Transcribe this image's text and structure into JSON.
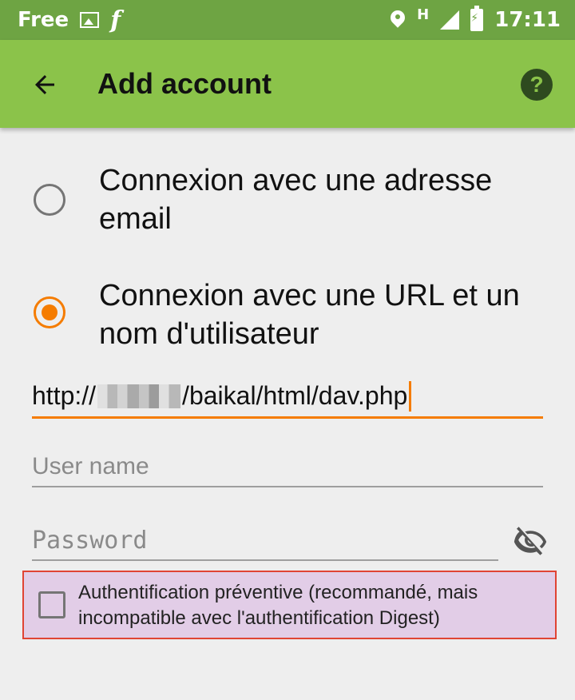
{
  "status_bar": {
    "carrier": "Free",
    "network_type": "H",
    "time": "17:11"
  },
  "toolbar": {
    "title": "Add account",
    "back_icon": "arrow-left-icon",
    "help_icon": "help-circle-icon",
    "help_glyph": "?"
  },
  "login_options": [
    {
      "label": "Connexion avec une adresse email",
      "selected": false
    },
    {
      "label": "Connexion avec une URL et un nom d'utilisateur",
      "selected": true
    }
  ],
  "url_field": {
    "prefix": "http://",
    "suffix": "/baikal/html/dav.php"
  },
  "username_field": {
    "placeholder": "User name",
    "value": ""
  },
  "password_field": {
    "placeholder": "Password",
    "value": ""
  },
  "preemptive_auth": {
    "label": "Authentification préventive (recommandé, mais incompatible avec l'authentification Digest)",
    "checked": false
  },
  "colors": {
    "status_bar": "#6ea443",
    "toolbar": "#8bc34a",
    "accent": "#f57c00",
    "highlight_bg": "#e2cde7",
    "highlight_border": "#e04434"
  }
}
